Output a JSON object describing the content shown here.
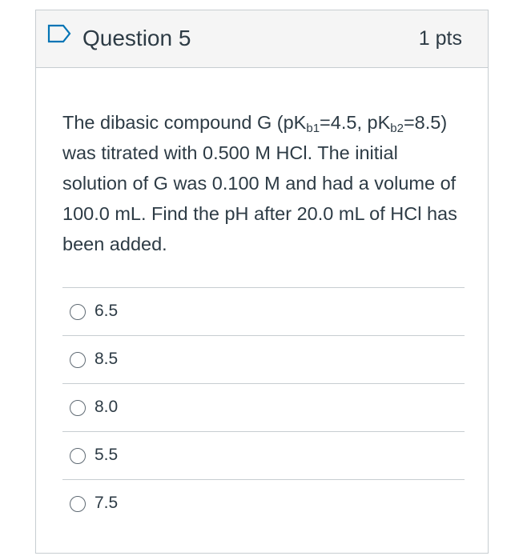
{
  "question": {
    "title": "Question 5",
    "points": "1 pts",
    "text": {
      "part1": "The dibasic compound G (pK",
      "sub1": "b1",
      "part2": "=4.5, pK",
      "sub2": "b2",
      "part3": "=8.5) was titrated with 0.500 M HCl. The initial solution of G was 0.100 M and had a volume of 100.0 mL. Find the pH after 20.0 mL of HCl has been added."
    },
    "answers": [
      {
        "label": "6.5",
        "selected": false
      },
      {
        "label": "8.5",
        "selected": false
      },
      {
        "label": "8.0",
        "selected": false
      },
      {
        "label": "5.5",
        "selected": false
      },
      {
        "label": "7.5",
        "selected": false
      }
    ]
  },
  "icons": {
    "flag": "bookmark-flag-icon",
    "radio": "radio-unchecked-icon"
  },
  "colors": {
    "text": "#2d3b45",
    "border": "#c7cdd1",
    "header_bg": "#f5f5f5",
    "flag_stroke": "#0374b5"
  }
}
